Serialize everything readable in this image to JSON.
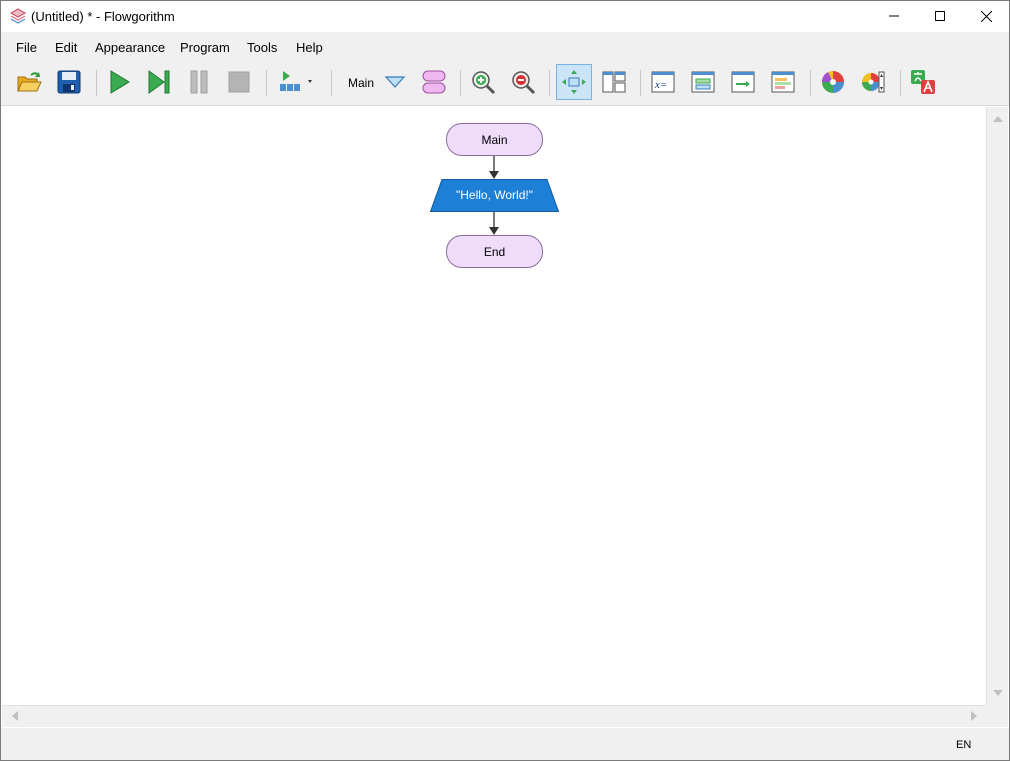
{
  "window": {
    "title": "(Untitled) * - Flowgorithm"
  },
  "menu": {
    "items": [
      {
        "label": "File"
      },
      {
        "label": "Edit"
      },
      {
        "label": "Appearance"
      },
      {
        "label": "Program"
      },
      {
        "label": "Tools"
      },
      {
        "label": "Help"
      }
    ]
  },
  "toolbar": {
    "function_selector": "Main",
    "icons": [
      "open-folder-icon",
      "save-icon",
      "run-icon",
      "step-icon",
      "pause-icon",
      "stop-icon",
      "execute-speed-icon",
      "function-dropdown-icon",
      "add-function-icon",
      "zoom-in-icon",
      "zoom-out-icon",
      "layout-icon",
      "layout-panels-icon",
      "variable-watch-icon",
      "console-icon",
      "output-icon",
      "source-view-icon",
      "color-icon",
      "chart-style-icon",
      "translate-icon"
    ]
  },
  "flowchart": {
    "start_label": "Main",
    "output_text": "\"Hello, World!\"",
    "end_label": "End"
  },
  "colors": {
    "terminal_fill": "#eedcfa",
    "output_fill": "#1e7fd6",
    "active_tool": "#cce4f7"
  },
  "status": {
    "language": "EN"
  }
}
